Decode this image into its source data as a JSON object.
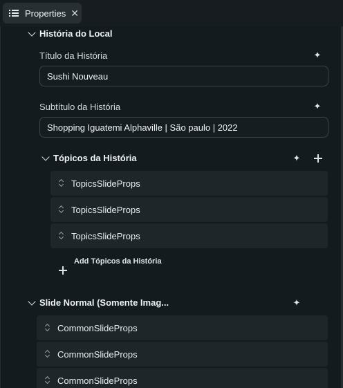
{
  "tab": {
    "label": "Properties",
    "list_icon": "list-icon",
    "close_icon": "close-icon"
  },
  "historia": {
    "title": "História do Local",
    "titulo_label": "Título da História",
    "titulo_value": "Sushi Nouveau",
    "subtitulo_label": "Subtítulo da História",
    "subtitulo_value": "Shopping Iguatemi Alphaville | São paulo | 2022",
    "topicos": {
      "title": "Tópicos da História",
      "items": [
        "TopicsSlideProps",
        "TopicsSlideProps",
        "TopicsSlideProps"
      ],
      "add_label": "Add Tópicos da História"
    }
  },
  "slide_normal": {
    "title": "Slide Normal (Somente Imag...",
    "items": [
      "CommonSlideProps",
      "CommonSlideProps",
      "CommonSlideProps"
    ]
  },
  "colors": {
    "background": "#141b1e",
    "row": "#1e2629",
    "border": "#3a4449",
    "text": "#e6ebec"
  }
}
